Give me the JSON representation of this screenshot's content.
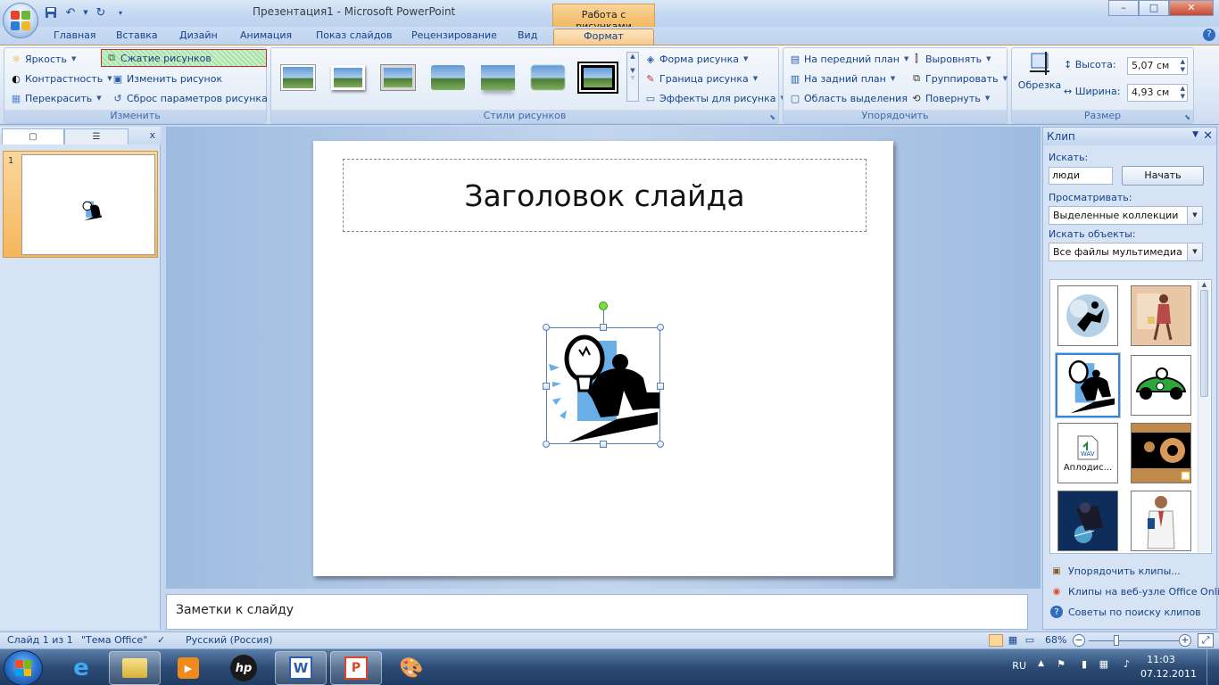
{
  "window": {
    "title": "Презентация1 - Microsoft PowerPoint",
    "context_tab_title": "Работа с рисунками",
    "controls": {
      "minimize": "–",
      "maximize": "□",
      "close": "✕"
    }
  },
  "quick_access": [
    {
      "icon": "save-icon"
    },
    {
      "icon": "undo-icon"
    },
    {
      "icon": "redo-icon"
    },
    {
      "icon": "customize-icon"
    }
  ],
  "tabs": [
    "Главная",
    "Вставка",
    "Дизайн",
    "Анимация",
    "Показ слайдов",
    "Рецензирование",
    "Вид",
    "Формат"
  ],
  "active_tab": "Формат",
  "ribbon": {
    "adjust": {
      "label": "Изменить",
      "brightness": "Яркость",
      "contrast": "Контрастность",
      "recolor": "Перекрасить",
      "compress": "Сжатие рисунков",
      "change_picture": "Изменить рисунок",
      "reset_picture": "Сброс параметров рисунка"
    },
    "picture_styles": {
      "label": "Стили рисунков",
      "shape": "Форма рисунка",
      "border": "Граница рисунка",
      "effects": "Эффекты для рисунка"
    },
    "arrange": {
      "label": "Упорядочить",
      "bring_front": "На передний план",
      "send_back": "На задний план",
      "selection_pane": "Область выделения",
      "align": "Выровнять",
      "group": "Группировать",
      "rotate": "Повернуть"
    },
    "size": {
      "label": "Размер",
      "crop": "Обрезка",
      "height_label": "Высота:",
      "height_value": "5,07 см",
      "width_label": "Ширина:",
      "width_value": "4,93 см"
    }
  },
  "slides_pane": {
    "slide_number": "1",
    "close": "x"
  },
  "slide": {
    "title": "Заголовок слайда"
  },
  "notes": {
    "placeholder": "Заметки к слайду"
  },
  "clip_pane": {
    "title": "Клип",
    "search_label": "Искать:",
    "search_value": "люди",
    "go_button": "Начать",
    "browse_label": "Просматривать:",
    "browse_value": "Выделенные коллекции",
    "types_label": "Искать объекты:",
    "types_value": "Все файлы мультимедиа",
    "clip_caption": "Аплодис...",
    "links": [
      {
        "icon": "organize-clips-icon",
        "label": "Упорядочить клипы..."
      },
      {
        "icon": "office-online-icon",
        "label": "Клипы на веб-узле Office Online"
      },
      {
        "icon": "help-icon",
        "label": "Советы по поиску клипов"
      }
    ]
  },
  "status": {
    "slide_info": "Слайд 1 из 1",
    "theme": "\"Тема Office\"",
    "language": "Русский (Россия)",
    "zoom": "68%"
  },
  "taskbar": {
    "lang": "RU",
    "time": "11:03",
    "date": "07.12.2011"
  },
  "colors": {
    "ribbon_accent": "#f9c98c",
    "link_blue": "#15428b",
    "selection_green": "#7cdc3c"
  }
}
